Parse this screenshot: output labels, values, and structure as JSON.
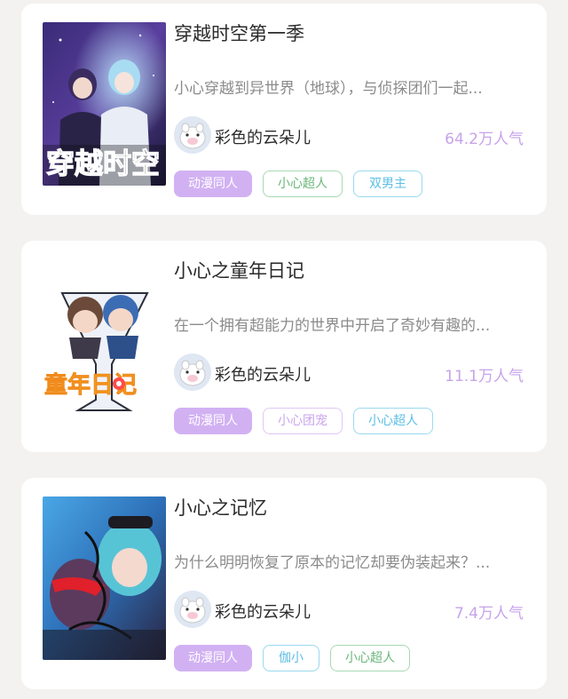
{
  "cards": [
    {
      "title": "穿越时空第一季",
      "description": "小心穿越到异世界（地球），与侦探团们一起...",
      "author": "彩色的云朵儿",
      "popularity": "64.2万人气",
      "cover_text": "穿越时空",
      "tags": [
        "动漫同人",
        "小心超人",
        "双男主"
      ]
    },
    {
      "title": "小心之童年日记",
      "description": "在一个拥有超能力的世界中开启了奇妙有趣的...",
      "author": "彩色的云朵儿",
      "popularity": "11.1万人气",
      "cover_text": "童年日记",
      "tags": [
        "动漫同人",
        "小心团宠",
        "小心超人"
      ]
    },
    {
      "title": "小心之记忆",
      "description": "为什么明明恢复了原本的记忆却要伪装起来？...",
      "author": "彩色的云朵儿",
      "popularity": "7.4万人气",
      "tags": [
        "动漫同人",
        "伽小",
        "小心超人"
      ]
    }
  ],
  "colors": {
    "accent_purple": "#d2b1f3",
    "popularity_text": "#c7a3ea",
    "tag_green": "#6ab77a",
    "tag_blue": "#5bbfe4"
  },
  "icons": {
    "avatar": "pig-avatar-icon"
  }
}
